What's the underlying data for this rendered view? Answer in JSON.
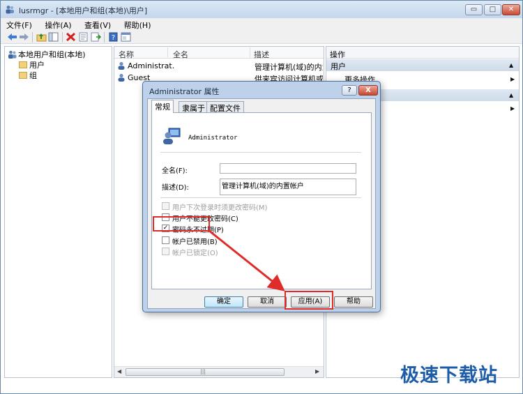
{
  "window": {
    "title": "lusrmgr - [本地用户和组(本地)\\用户]",
    "minimize": "▭",
    "maximize": "□",
    "close": "✕"
  },
  "menu": [
    "文件(F)",
    "操作(A)",
    "查看(V)",
    "帮助(H)"
  ],
  "tree": {
    "root": "本地用户和组(本地)",
    "children": [
      "用户",
      "组"
    ]
  },
  "list": {
    "columns": [
      "名称",
      "全名",
      "描述"
    ],
    "rows": [
      {
        "name": "Administrat...",
        "fullname": "",
        "desc": "管理计算机(域)的内置帐"
      },
      {
        "name": "Guest",
        "fullname": "",
        "desc": "供来宾访问计算机或访问"
      }
    ],
    "scroll_glyph": "|||"
  },
  "actions": {
    "header": "操作",
    "section1": "用户",
    "item1": "更多操作"
  },
  "dialog": {
    "title": "Administrator 属性",
    "help_btn": "?",
    "close_btn": "X",
    "tabs": [
      "常规",
      "隶属于",
      "配置文件"
    ],
    "account_name": "Administrator",
    "fullname_label": "全名(F):",
    "fullname_value": "",
    "desc_label": "描述(D):",
    "desc_value": "管理计算机(域)的内置帐户",
    "checkboxes": [
      {
        "label": "用户下次登录时须更改密码(M)",
        "checked": false,
        "disabled": true
      },
      {
        "label": "用户不能更改密码(C)",
        "checked": false,
        "disabled": false
      },
      {
        "label": "密码永不过期(P)",
        "checked": true,
        "disabled": false
      },
      {
        "label": "帐户已禁用(B)",
        "checked": false,
        "disabled": false
      },
      {
        "label": "帐户已锁定(O)",
        "checked": false,
        "disabled": true
      }
    ],
    "buttons": {
      "ok": "确定",
      "cancel": "取消",
      "apply": "应用(A)",
      "help": "帮助"
    }
  },
  "colors": {
    "highlight": "#e02b2b",
    "watermark": "#1d5ca8"
  },
  "watermark": "极速下载站"
}
